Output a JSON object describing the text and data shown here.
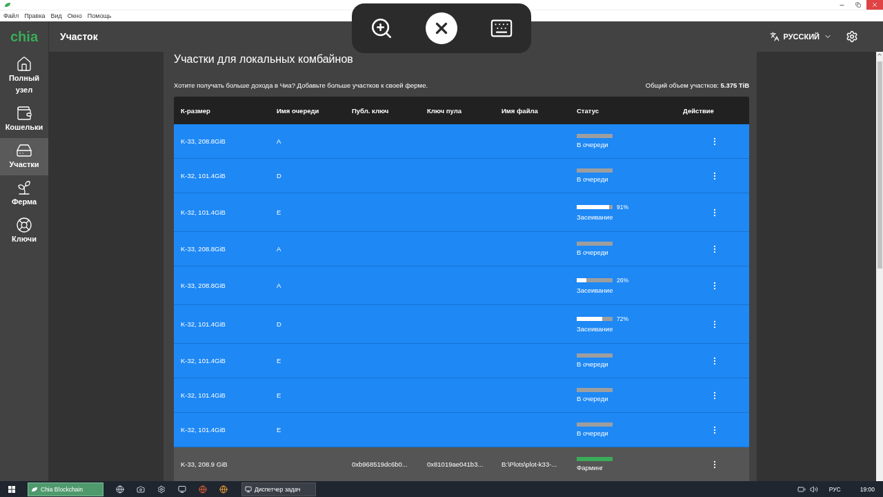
{
  "menu": [
    "Файл",
    "Правка",
    "Вид",
    "Окно",
    "Помощь"
  ],
  "header": {
    "logo": "chia",
    "title": "Участок",
    "language": "РУССКИЙ"
  },
  "sidebar": {
    "items": [
      {
        "label": "Полный узел",
        "selected": false
      },
      {
        "label": "Кошельки",
        "selected": false
      },
      {
        "label": "Участки",
        "selected": true
      },
      {
        "label": "Ферма",
        "selected": false
      },
      {
        "label": "Ключи",
        "selected": false
      }
    ]
  },
  "section": {
    "title": "Участки для локальных комбайнов",
    "hint": "Хотите получать больше дохода в Чиа? Добавьте больше участков к своей ферме.",
    "total": "Общий объем участков: **5.375 TiB**"
  },
  "table": {
    "columns": [
      "К-размер",
      "Имя очереди",
      "Публ. ключ",
      "Ключ пула",
      "Имя файла",
      "Статус",
      "Действие"
    ],
    "rows": [
      {
        "size": "K-33, 208.8GiB",
        "queue": "A",
        "status": {
          "kind": "queued",
          "label": "В очереди"
        }
      },
      {
        "size": "K-32, 101.4GiB",
        "queue": "D",
        "status": {
          "kind": "queued",
          "label": "В очереди"
        }
      },
      {
        "size": "K-32, 101.4GiB",
        "queue": "E",
        "status": {
          "kind": "seeding",
          "label": "Засеивание",
          "level": 0.91,
          "percent": "91%"
        }
      },
      {
        "size": "K-33, 208.8GiB",
        "queue": "A",
        "status": {
          "kind": "queued",
          "label": "В очереди"
        }
      },
      {
        "size": "K-33, 208.8GiB",
        "queue": "A",
        "status": {
          "kind": "seeding",
          "label": "Засеивание",
          "level": 0.26,
          "percent": "26%"
        }
      },
      {
        "size": "K-32, 101.4GiB",
        "queue": "D",
        "status": {
          "kind": "seeding",
          "label": "Засеивание",
          "level": 0.72,
          "percent": "72%"
        }
      },
      {
        "size": "K-32, 101.4GiB",
        "queue": "E",
        "status": {
          "kind": "queued",
          "label": "В очереди"
        }
      },
      {
        "size": "K-32, 101.4GiB",
        "queue": "E",
        "status": {
          "kind": "queued",
          "label": "В очереди"
        }
      },
      {
        "size": "K-32, 101.4GiB",
        "queue": "E",
        "status": {
          "kind": "queued",
          "label": "В очереди"
        }
      },
      {
        "size": "K-33, 208.9 GiB",
        "public_key": "0xb968519dc6b0...",
        "pool_key": "0x81019ae041b3...",
        "file": "B:\\Plots\\plot-k33-...",
        "status": {
          "kind": "farming",
          "label": "Фарминг"
        }
      }
    ]
  },
  "taskbar": {
    "apps": [
      {
        "label": "Chia Blockchain",
        "selected": true
      },
      {
        "label": "Диспетчер задач",
        "selected": false
      }
    ],
    "language": "РУС",
    "time": "19:00"
  }
}
